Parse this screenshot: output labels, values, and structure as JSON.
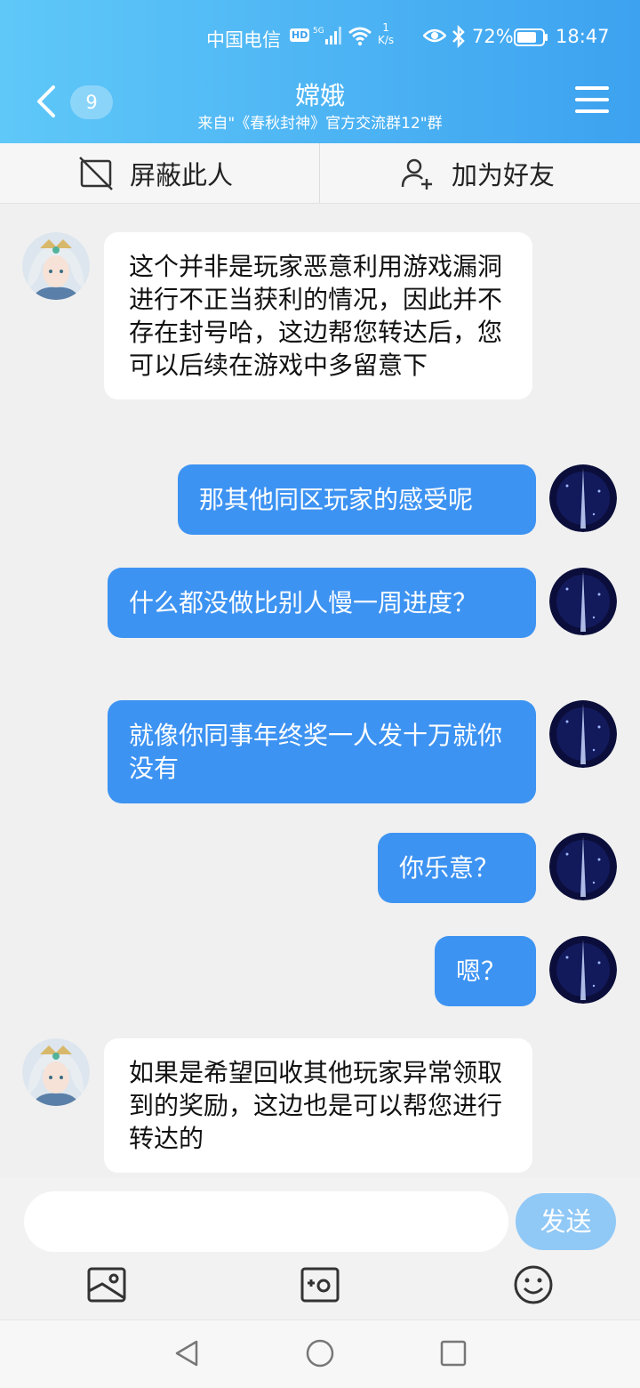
{
  "status_bar": {
    "carrier": "中国电信",
    "hd": "HD",
    "net_speed_value": "1",
    "net_speed_unit": "K/s",
    "battery": "72%",
    "time": "18:47"
  },
  "header": {
    "unread_count": "9",
    "title": "嫦娥",
    "subtitle": "来自\"《春秋封神》官方交流群12\"群"
  },
  "actions": {
    "block_label": "屏蔽此人",
    "add_friend_label": "加为好友"
  },
  "messages": [
    {
      "direction": "incoming",
      "text": "这个并非是玩家恶意利用游戏漏洞进行不正当获利的情况，因此并不存在封号哈，这边帮您转达后，您可以后续在游戏中多留意下"
    },
    {
      "direction": "outgoing",
      "text": "那其他同区玩家的感受呢"
    },
    {
      "direction": "outgoing",
      "text": "什么都没做比别人慢一周进度？"
    },
    {
      "direction": "outgoing",
      "text": "就像你同事年终奖一人发十万就你没有"
    },
    {
      "direction": "outgoing",
      "text": "你乐意？"
    },
    {
      "direction": "outgoing",
      "text": "嗯？"
    },
    {
      "direction": "incoming",
      "text": "如果是希望回收其他玩家异常领取到的奖励，这边也是可以帮您进行转达的"
    }
  ],
  "composer": {
    "input_value": "",
    "send_label": "发送",
    "tools": [
      "image-icon",
      "camera-icon",
      "emoji-icon"
    ]
  },
  "colors": {
    "header_start": "#5fc8f8",
    "header_end": "#3da2f0",
    "outgoing_bubble": "#3d93f2",
    "incoming_bubble": "#ffffff",
    "send_button": "#90c8f6"
  }
}
